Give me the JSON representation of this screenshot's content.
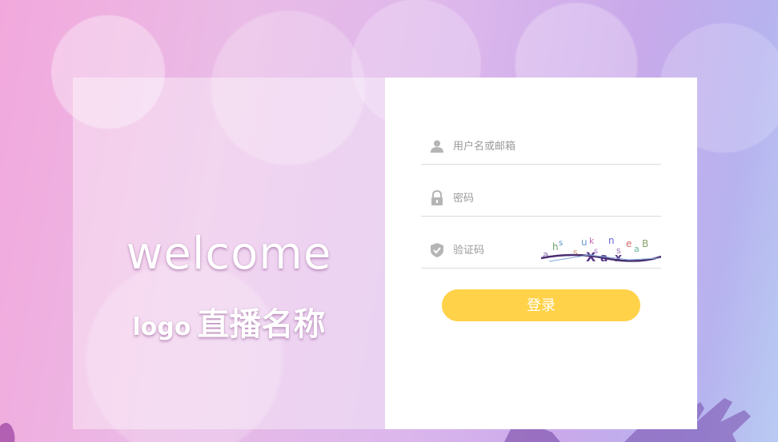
{
  "brand": {
    "welcome": "welcome",
    "logo_word": "logo",
    "site_name": "直播名称"
  },
  "form": {
    "username": {
      "placeholder": "用户名或邮箱",
      "icon": "user-icon"
    },
    "password": {
      "placeholder": "密码",
      "icon": "lock-icon"
    },
    "captcha": {
      "placeholder": "验证码",
      "icon": "shield-check-icon",
      "image_text": "ahsuksnseaB"
    },
    "submit_label": "登录"
  },
  "colors": {
    "button": "#ffd249",
    "icon": "#b5b5b5",
    "panel": "#ffffff"
  }
}
